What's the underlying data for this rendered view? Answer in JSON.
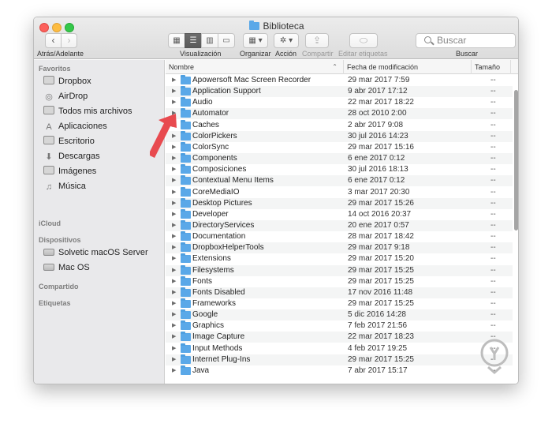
{
  "window": {
    "title": "Biblioteca"
  },
  "toolbar": {
    "nav_label": "Atrás/Adelante",
    "view_label": "Visualización",
    "arrange_label": "Organizar",
    "action_label": "Acción",
    "share_label": "Compartir",
    "tags_label": "Editar etiquetas",
    "search_label": "Buscar",
    "search_placeholder": "Buscar",
    "back_icon": "‹",
    "forward_icon": "›",
    "view_icons": [
      "▦",
      "☰",
      "▥",
      "▭"
    ],
    "arrange_icon": "▦ ▾",
    "action_icon": "✲ ▾",
    "share_icon": "⇪",
    "tags_icon": "⬭"
  },
  "sidebar": {
    "favorites_header": "Favoritos",
    "favorites": [
      {
        "label": "Dropbox",
        "icon": "box-icon"
      },
      {
        "label": "AirDrop",
        "icon": "airdrop-icon"
      },
      {
        "label": "Todos mis archivos",
        "icon": "all-files-icon"
      },
      {
        "label": "Aplicaciones",
        "icon": "applications-icon"
      },
      {
        "label": "Escritorio",
        "icon": "desktop-icon"
      },
      {
        "label": "Descargas",
        "icon": "downloads-icon"
      },
      {
        "label": "Imágenes",
        "icon": "camera-icon"
      },
      {
        "label": "Música",
        "icon": "music-icon"
      }
    ],
    "icloud_header": "iCloud",
    "devices_header": "Dispositivos",
    "devices": [
      {
        "label": "Solvetic macOS Server",
        "icon": "server-icon"
      },
      {
        "label": "Mac OS",
        "icon": "disk-icon"
      }
    ],
    "shared_header": "Compartido",
    "tags_header": "Etiquetas"
  },
  "columns": {
    "name": "Nombre",
    "date": "Fecha de modificación",
    "size": "Tamaño"
  },
  "files": [
    {
      "name": "Apowersoft Mac Screen Recorder",
      "date": "29 mar 2017 7:59",
      "size": "--"
    },
    {
      "name": "Application Support",
      "date": "9 abr 2017 17:12",
      "size": "--"
    },
    {
      "name": "Audio",
      "date": "22 mar 2017 18:22",
      "size": "--"
    },
    {
      "name": "Automator",
      "date": "28 oct 2010 2:00",
      "size": "--"
    },
    {
      "name": "Caches",
      "date": "2 abr 2017 9:08",
      "size": "--"
    },
    {
      "name": "ColorPickers",
      "date": "30 jul 2016 14:23",
      "size": "--"
    },
    {
      "name": "ColorSync",
      "date": "29 mar 2017 15:16",
      "size": "--"
    },
    {
      "name": "Components",
      "date": "6 ene 2017 0:12",
      "size": "--"
    },
    {
      "name": "Composiciones",
      "date": "30 jul 2016 18:13",
      "size": "--"
    },
    {
      "name": "Contextual Menu Items",
      "date": "6 ene 2017 0:12",
      "size": "--"
    },
    {
      "name": "CoreMediaIO",
      "date": "3 mar 2017 20:30",
      "size": "--"
    },
    {
      "name": "Desktop Pictures",
      "date": "29 mar 2017 15:26",
      "size": "--"
    },
    {
      "name": "Developer",
      "date": "14 oct 2016 20:37",
      "size": "--"
    },
    {
      "name": "DirectoryServices",
      "date": "20 ene 2017 0:57",
      "size": "--"
    },
    {
      "name": "Documentation",
      "date": "28 mar 2017 18:42",
      "size": "--"
    },
    {
      "name": "DropboxHelperTools",
      "date": "29 mar 2017 9:18",
      "size": "--"
    },
    {
      "name": "Extensions",
      "date": "29 mar 2017 15:20",
      "size": "--"
    },
    {
      "name": "Filesystems",
      "date": "29 mar 2017 15:25",
      "size": "--"
    },
    {
      "name": "Fonts",
      "date": "29 mar 2017 15:25",
      "size": "--"
    },
    {
      "name": "Fonts Disabled",
      "date": "17 nov 2016 11:48",
      "size": "--"
    },
    {
      "name": "Frameworks",
      "date": "29 mar 2017 15:25",
      "size": "--"
    },
    {
      "name": "Google",
      "date": "5 dic 2016 14:28",
      "size": "--"
    },
    {
      "name": "Graphics",
      "date": "7 feb 2017 21:56",
      "size": "--"
    },
    {
      "name": "Image Capture",
      "date": "22 mar 2017 18:23",
      "size": "--"
    },
    {
      "name": "Input Methods",
      "date": "4 feb 2017 19:25",
      "size": "--"
    },
    {
      "name": "Internet Plug-Ins",
      "date": "29 mar 2017 15:25",
      "size": "--"
    },
    {
      "name": "Java",
      "date": "7 abr 2017 15:17",
      "size": "--"
    }
  ],
  "colors": {
    "folder": "#5aa8e8",
    "arrow": "#e84a4f",
    "sidebar_bg": "#e9e9eb",
    "close": "#fc605b",
    "minimize": "#fdbc40",
    "maximize": "#34c84a"
  }
}
